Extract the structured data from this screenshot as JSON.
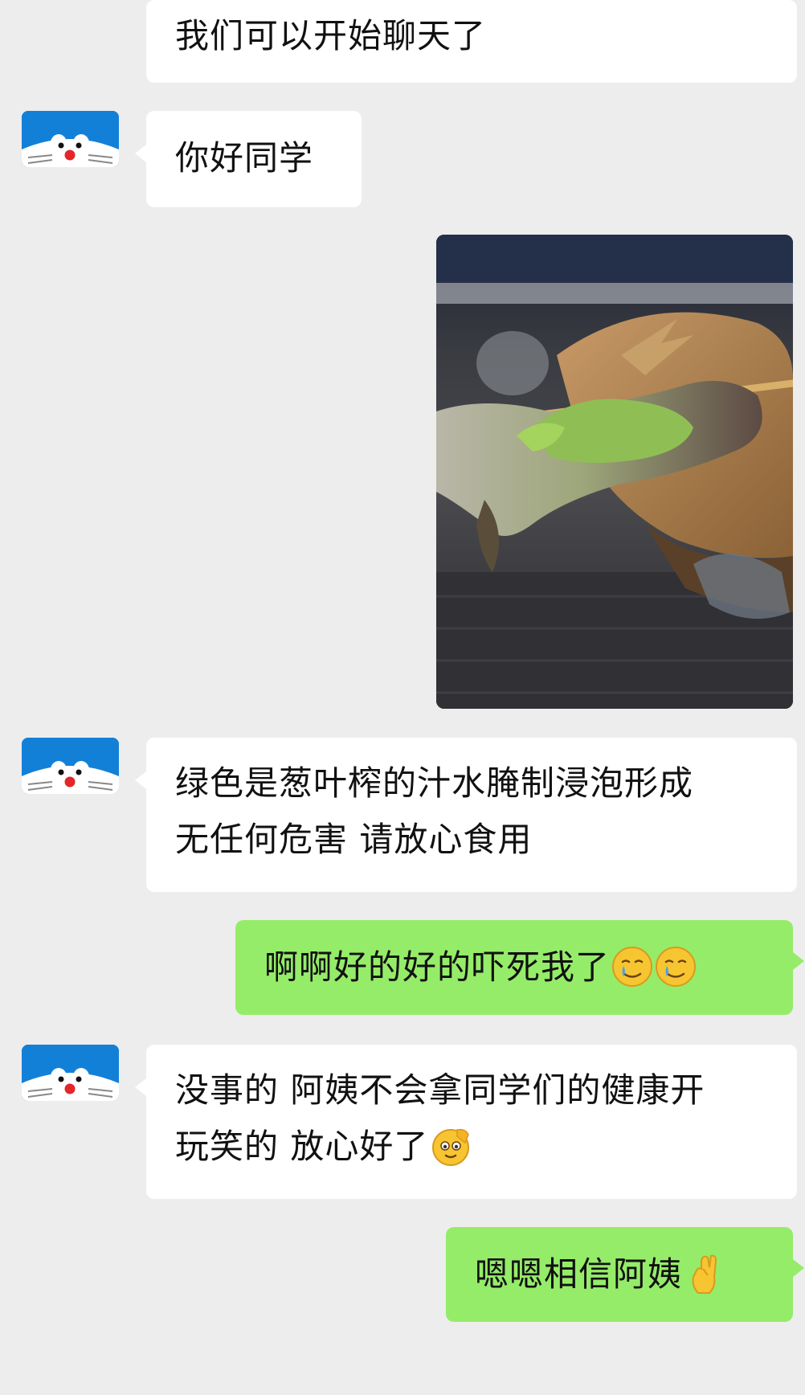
{
  "messages": [
    {
      "side": "left",
      "lines": [
        "我们可以开始聊天了"
      ]
    },
    {
      "side": "left",
      "lines": [
        "你好同学"
      ]
    },
    {
      "side": "right",
      "type": "image",
      "icon": "food-photo"
    },
    {
      "side": "left",
      "lines": [
        "绿色是葱叶榨的汁水腌制浸泡形成",
        "无任何危害 请放心食用"
      ]
    },
    {
      "side": "right",
      "lines": [
        "啊啊好的好的吓死我了"
      ],
      "emoji": [
        "crying-smile-emoji",
        "crying-smile-emoji"
      ]
    },
    {
      "side": "left",
      "lines": [
        "没事的 阿姨不会拿同学们的健康开",
        "玩笑的 放心好了"
      ],
      "emoji": [
        "salute-emoji"
      ]
    },
    {
      "side": "right",
      "lines": [
        "嗯嗯相信阿姨"
      ],
      "emoji": [
        "fingers-crossed-emoji"
      ]
    }
  ],
  "colors": {
    "background": "#ededed",
    "incoming_bubble": "#ffffff",
    "outgoing_bubble": "#95ec69",
    "avatar": "#1380d8"
  }
}
